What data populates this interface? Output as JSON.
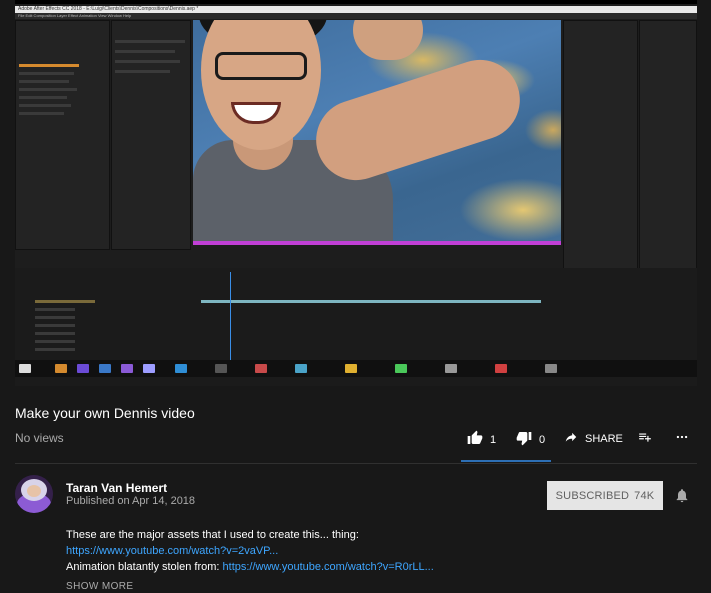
{
  "video": {
    "app_title": "Adobe After Effects CC 2018 - E:\\Luigi\\Clients\\Dennis\\Compositions\\Dennis.aep *",
    "menubar": "File  Edit  Composition  Layer  Effect  Animation  View  Window  Help"
  },
  "title": "Make your own Dennis video",
  "views": "No views",
  "actions": {
    "likes": "1",
    "dislikes": "0",
    "share": "SHARE",
    "like_ratio": 1.0
  },
  "channel": {
    "name": "Taran Van Hemert",
    "published": "Published on Apr 14, 2018",
    "subscribe_label": "SUBSCRIBED",
    "subscriber_count": "74K"
  },
  "description": {
    "line1": "These are the major assets that I used to create this... thing:",
    "link1": "https://www.youtube.com/watch?v=2vaVP...",
    "line3_prefix": "Animation blatantly stolen from:",
    "link2": "https://www.youtube.com/watch?v=R0rLL..."
  },
  "show_more": "SHOW MORE",
  "colors": {
    "background": "#181818",
    "link": "#3ea6ff",
    "secondary_text": "#aaaaaa"
  }
}
